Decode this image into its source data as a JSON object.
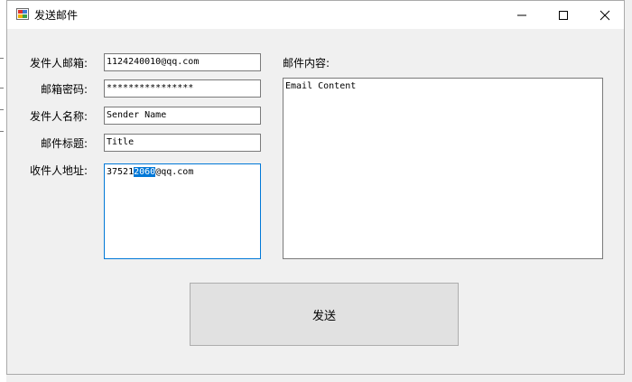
{
  "window": {
    "title": "发送邮件"
  },
  "labels": {
    "sender_email": "发件人邮箱:",
    "email_password": "邮箱密码:",
    "sender_name": "发件人名称:",
    "email_subject": "邮件标题:",
    "recipient_address": "收件人地址:",
    "email_content": "邮件内容:"
  },
  "fields": {
    "sender_email": "1124240010@qq.com",
    "email_password": "****************",
    "sender_name": "Sender Name",
    "email_subject": "Title",
    "recipient_before": "37521",
    "recipient_selected": "2060",
    "recipient_after": "@qq.com",
    "email_content": "Email Content"
  },
  "buttons": {
    "send": "发送"
  },
  "icons": {
    "app": "mail-app-icon",
    "minimize": "minimize-icon",
    "maximize": "maximize-icon",
    "close": "close-icon"
  },
  "colors": {
    "selection": "#0078d7",
    "button_bg": "#e1e1e1",
    "window_bg": "#f0f0f0"
  }
}
